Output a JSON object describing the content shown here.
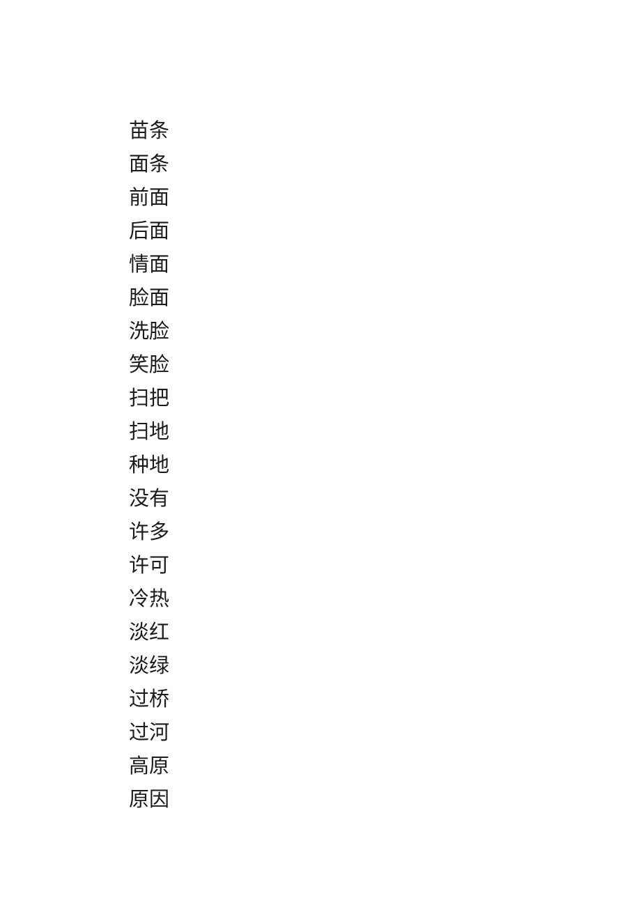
{
  "document": {
    "page_background": "#ffffff",
    "text_color": "#1b1b1b",
    "lines": [
      {
        "text": "苗条"
      },
      {
        "text": "面条"
      },
      {
        "text": "前面"
      },
      {
        "text": "后面"
      },
      {
        "text": "情面"
      },
      {
        "text": "脸面"
      },
      {
        "text": "洗脸"
      },
      {
        "text": "笑脸"
      },
      {
        "text": "扫把"
      },
      {
        "text": "扫地"
      },
      {
        "text": "种地"
      },
      {
        "text": "没有"
      },
      {
        "text": "许多"
      },
      {
        "text": "许可"
      },
      {
        "text": "冷热"
      },
      {
        "text": "淡红"
      },
      {
        "text": "淡绿"
      },
      {
        "text": "过桥"
      },
      {
        "text": "过河"
      },
      {
        "text": "高原"
      },
      {
        "text": "原因"
      }
    ]
  }
}
